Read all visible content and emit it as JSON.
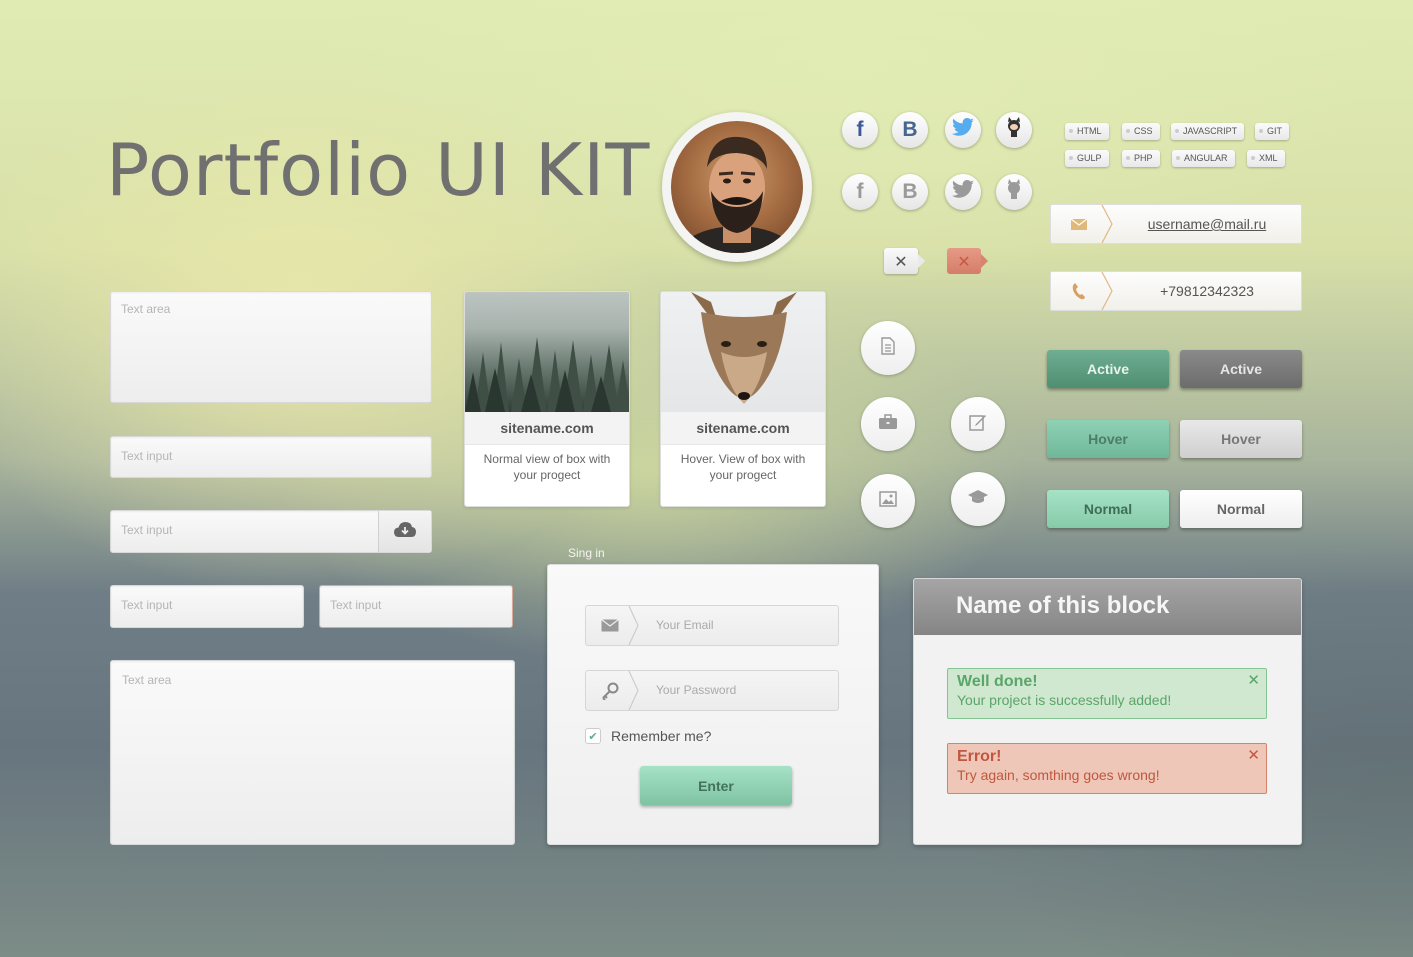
{
  "title": "Portfolio UI KIT",
  "form": {
    "textarea1_placeholder": "Text area",
    "input1_placeholder": "Text input",
    "input_upload_placeholder": "Text input",
    "input_small_placeholder": "Text input",
    "input_error_placeholder": "Text input",
    "textarea2_placeholder": "Text area"
  },
  "cards": [
    {
      "site": "sitename.com",
      "desc": "Normal view of box with your progect"
    },
    {
      "site": "sitename.com",
      "desc": "Hover. View of box with your progect"
    }
  ],
  "social": {
    "facebook": "f",
    "vk": "B"
  },
  "tags": {
    "row1": [
      "HTML",
      "CSS",
      "JAVASCRIPT",
      "GIT"
    ],
    "row2": [
      "GULP",
      "PHP",
      "ANGULAR",
      "XML"
    ]
  },
  "contact": {
    "email": "username@mail.ru",
    "phone": "+79812342323"
  },
  "buttons": {
    "active_green": "Active",
    "active_grey": "Active",
    "hover_green": "Hover",
    "hover_grey": "Hover",
    "normal_green": "Normal",
    "normal_grey": "Normal"
  },
  "signin": {
    "label": "Sing in",
    "email_placeholder": "Your Email",
    "password_placeholder": "Your Password",
    "remember": "Remember me?",
    "submit": "Enter"
  },
  "notifications": {
    "title": "Name of this block",
    "success_title": "Well done!",
    "success_message": "Your project is successfully added!",
    "error_title": "Error!",
    "error_message": "Try again, somthing goes wrong!"
  },
  "colors": {
    "accent_green": "#6fb798",
    "error_red": "#c0573e",
    "success_green": "#5aa56a",
    "facebook": "#3b5998",
    "vk": "#45668e",
    "twitter": "#55acee"
  }
}
